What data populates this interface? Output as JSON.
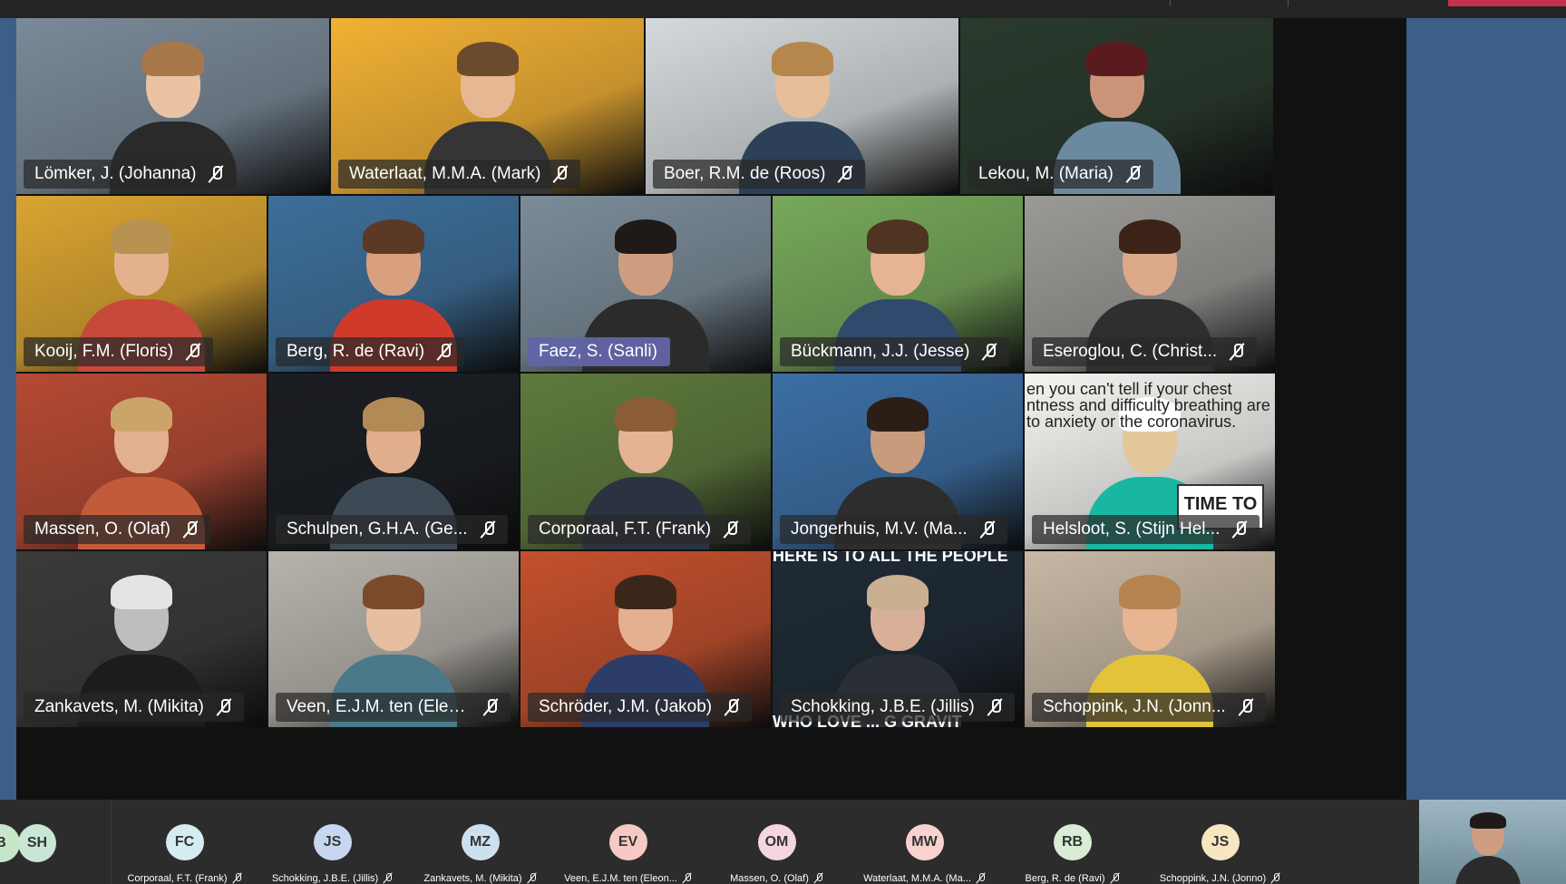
{
  "participants": [
    {
      "name": "Lömker, J. (Johanna)",
      "bg": "#7a8a98",
      "skin": "#e9c3a3",
      "hair": "#a8774a",
      "shirt": "#2a2a2a"
    },
    {
      "name": "Waterlaat, M.M.A. (Mark)",
      "bg": "#f2b134",
      "skin": "#e7b794",
      "hair": "#6b4a2e",
      "shirt": "#353535"
    },
    {
      "name": "Boer, R.M. de (Roos)",
      "bg": "#d4d9dc",
      "skin": "#e6be9a",
      "hair": "#b6874c",
      "shirt": "#2c4158"
    },
    {
      "name": "Lekou, M. (Maria)",
      "bg": "#2a3a2d",
      "skin": "#c9947a",
      "hair": "#5a1b1f",
      "shirt": "#6b8aa0"
    },
    {
      "name": "Kooij, F.M. (Floris)",
      "bg": "#d9a431",
      "skin": "#e4b18f",
      "hair": "#b79251",
      "shirt": "#c7493a"
    },
    {
      "name": "Berg, R. de (Ravi)",
      "bg": "#3d6f9a",
      "skin": "#d9a07f",
      "hair": "#5b3924",
      "shirt": "#d03a2b"
    },
    {
      "name": "Faez, S. (Sanli)",
      "bg": "#7b8c99",
      "skin": "#cf9e80",
      "hair": "#1f1a17",
      "shirt": "#2b2b2b"
    },
    {
      "name": "Bückmann, J.J. (Jesse)",
      "bg": "#77a85a",
      "skin": "#e6b393",
      "hair": "#4f3521",
      "shirt": "#304a6e"
    },
    {
      "name": "Eseroglou, C. (Christ...",
      "bg": "#9c9a97",
      "skin": "#dca98a",
      "hair": "#3b2417",
      "shirt": "#2f2f2f"
    },
    {
      "name": "Massen, O. (Olaf)",
      "bg": "#b54a33",
      "skin": "#e2b08e",
      "hair": "#cba46a",
      "shirt": "#c25b3a"
    },
    {
      "name": "Schulpen, G.H.A. (Ge...",
      "bg": "#1a1d22",
      "skin": "#e1ae8d",
      "hair": "#b28a55",
      "shirt": "#3d4a56"
    },
    {
      "name": "Corporaal, F.T. (Frank)",
      "bg": "#5e7a3c",
      "skin": "#e3b393",
      "hair": "#8a5d35",
      "shirt": "#2c3340"
    },
    {
      "name": "Jongerhuis, M.V. (Ma...",
      "bg": "#3c6fa5",
      "skin": "#c89b7d",
      "hair": "#2a1e17",
      "shirt": "#2d2d2d"
    },
    {
      "name": "Helsloot, S. (Stijn Hel...",
      "bg": "#f4f4f1",
      "skin": "#e3c79b",
      "hair": "#ffffff",
      "shirt": "#19b7a2"
    },
    {
      "name": "Zankavets, M. (Mikita)",
      "bg": "#3a3a3a",
      "skin": "#bdbdbd",
      "hair": "#e4e4e4",
      "shirt": "#1c1c1c"
    },
    {
      "name": "Veen, E.J.M. ten (Eleo...",
      "bg": "#b7b3ac",
      "skin": "#e6bea0",
      "hair": "#7a4a2b",
      "shirt": "#4a7a8a"
    },
    {
      "name": "Schröder, J.M. (Jakob)",
      "bg": "#c3502d",
      "skin": "#e4b091",
      "hair": "#3a2719",
      "shirt": "#2d3d6a"
    },
    {
      "name": "Schokking, J.B.E. (Jillis)",
      "bg": "#1e2a35",
      "skin": "#d8b09a",
      "hair": "#c9b090",
      "shirt": "#2a2f35"
    },
    {
      "name": "Schoppink, J.N. (Jonn...",
      "bg": "#c7b8a4",
      "skin": "#e8b592",
      "hair": "#b5834f",
      "shirt": "#e3c33a"
    }
  ],
  "overlays": {
    "helsloot_meme_line1": "en you can't tell if your chest",
    "helsloot_meme_line2": "ntness and difficulty breathing are",
    "helsloot_meme_line3": "to anxiety or the coronavirus.",
    "helsloot_meme_sign": "TIME TO",
    "schokking_top": "HERE IS TO ALL THE PEOPLE",
    "schokking_bottom": "WHO LOVE ... G GRAVIT"
  },
  "tray": [
    {
      "initials": "B",
      "label": "",
      "color": "#c8e6c9"
    },
    {
      "initials": "SH",
      "label": "",
      "color": "#c9e7d6"
    },
    {
      "initials": "FC",
      "label": "Corporaal, F.T. (Frank)",
      "color": "#d4ecf2"
    },
    {
      "initials": "JS",
      "label": "Schokking, J.B.E. (Jillis)",
      "color": "#c8d7f0"
    },
    {
      "initials": "MZ",
      "label": "Zankavets, M. (Mikita)",
      "color": "#cde0ee"
    },
    {
      "initials": "EV",
      "label": "Veen, E.J.M. ten (Eleon...",
      "color": "#f6c9c4"
    },
    {
      "initials": "OM",
      "label": "Massen, O. (Olaf)",
      "color": "#f5d5df"
    },
    {
      "initials": "MW",
      "label": "Waterlaat, M.M.A. (Ma...",
      "color": "#f8d2cf"
    },
    {
      "initials": "RB",
      "label": "Berg, R. de (Ravi)",
      "color": "#d9ecd4"
    },
    {
      "initials": "JS",
      "label": "Schoppink, J.N. (Jonno)",
      "color": "#f7e6c0"
    }
  ],
  "active_speaker_index": 6
}
